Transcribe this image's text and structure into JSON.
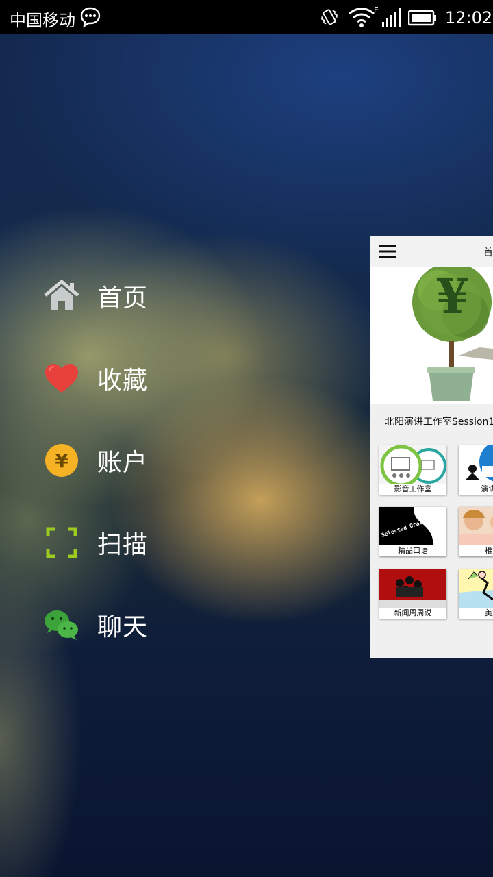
{
  "status_bar": {
    "carrier": "中国移动",
    "time": "12:02",
    "network_type": "E",
    "icons": [
      "message-icon",
      "vibrate-icon",
      "wifi-icon",
      "signal-icon",
      "battery-icon"
    ]
  },
  "menu": {
    "items": [
      {
        "label": "首页",
        "icon": "home-icon"
      },
      {
        "label": "收藏",
        "icon": "heart-icon"
      },
      {
        "label": "账户",
        "icon": "yuan-coin-icon"
      },
      {
        "label": "扫描",
        "icon": "scan-icon"
      },
      {
        "label": "聊天",
        "icon": "wechat-icon"
      }
    ]
  },
  "preview": {
    "title": "首",
    "banner_glyph": "¥",
    "caption": "北阳演讲工作室Session1",
    "tiles": [
      {
        "label": "影音工作室"
      },
      {
        "label": "演讲工"
      },
      {
        "label": "精品口语",
        "image_text": "Selected Oral English",
        "image_badge": "..."
      },
      {
        "label": "稚慧"
      },
      {
        "label": "新闻周周说"
      },
      {
        "label": "美文"
      }
    ]
  },
  "colors": {
    "heart": "#e53935",
    "coin": "#f5b225",
    "scan": "#9ccc1f",
    "wechat": "#3ca23a",
    "home": "#cfd2d2"
  }
}
